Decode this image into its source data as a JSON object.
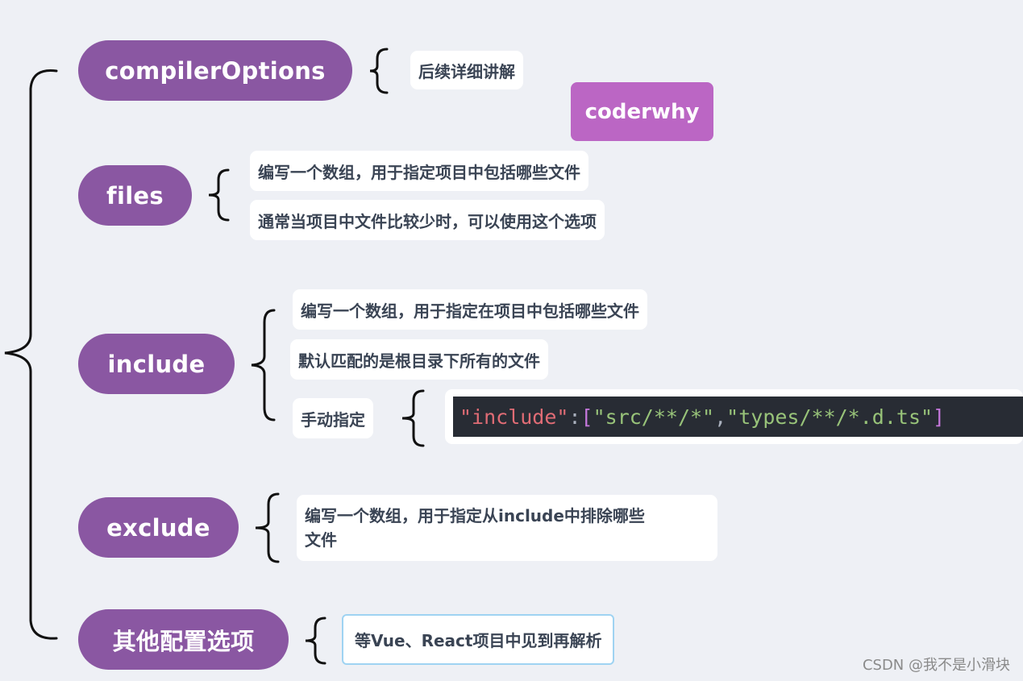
{
  "root_nodes": [
    {
      "label": "compilerOptions",
      "children": [
        "后续详细讲解"
      ]
    },
    {
      "label": "files",
      "children": [
        "编写一个数组，用于指定项目中包括哪些文件",
        "通常当项目中文件比较少时，可以使用这个选项"
      ]
    },
    {
      "label": "include",
      "children": [
        "编写一个数组，用于指定在项目中包括哪些文件",
        "默认匹配的是根目录下所有的文件",
        "手动指定"
      ]
    },
    {
      "label": "exclude",
      "children": [
        "编写一个数组，用于指定从include中排除哪些\n文件"
      ]
    },
    {
      "label": "其他配置选项",
      "children": [
        "等Vue、React项目中见到再解析"
      ]
    }
  ],
  "include_code": {
    "key": "\"include\"",
    "colon": ": ",
    "open": "[",
    "item1": "\"src/**/*\"",
    "comma": ", ",
    "item2": "\"types/**/*.d.ts\"",
    "close": "]"
  },
  "badge": "coderwhy",
  "watermark": "CSDN @我不是小滑块",
  "colors": {
    "node": "#8a57a2",
    "badge": "#bb66c4",
    "background": "#eef0f5",
    "code_bg": "#282c34"
  }
}
